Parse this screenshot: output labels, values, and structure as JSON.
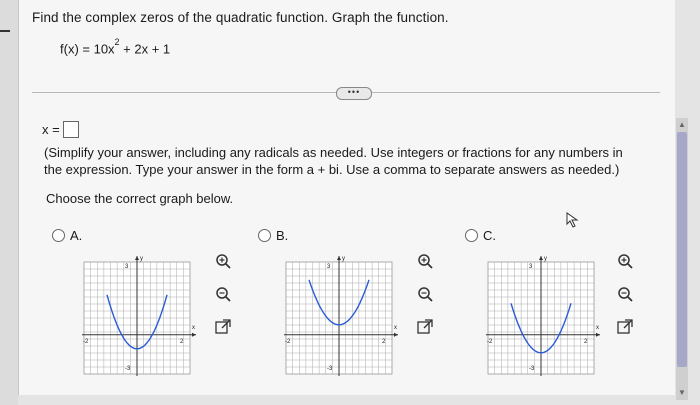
{
  "question": {
    "title": "Find the complex zeros of the quadratic function. Graph the function.",
    "function_lhs": "f(x) = 10x",
    "function_exp": "2",
    "function_rhs": " + 2x + 1"
  },
  "more_button": "•••",
  "answer": {
    "label": "x ="
  },
  "instructions": "(Simplify your answer, including any radicals as needed. Use integers or fractions for any numbers in the expression. Type your answer in the form a + bi. Use a comma to separate answers as needed.)",
  "choose_text": "Choose the correct graph below.",
  "options": [
    {
      "label": "A."
    },
    {
      "label": "B."
    },
    {
      "label": "C."
    }
  ],
  "graph_labels": {
    "y": "y",
    "x": "x",
    "ymax": "3",
    "ymin": "-3",
    "xmin": "-2",
    "xmax": "2"
  },
  "icons": [
    "zoom-in-icon",
    "zoom-out-icon",
    "external-link-icon"
  ]
}
